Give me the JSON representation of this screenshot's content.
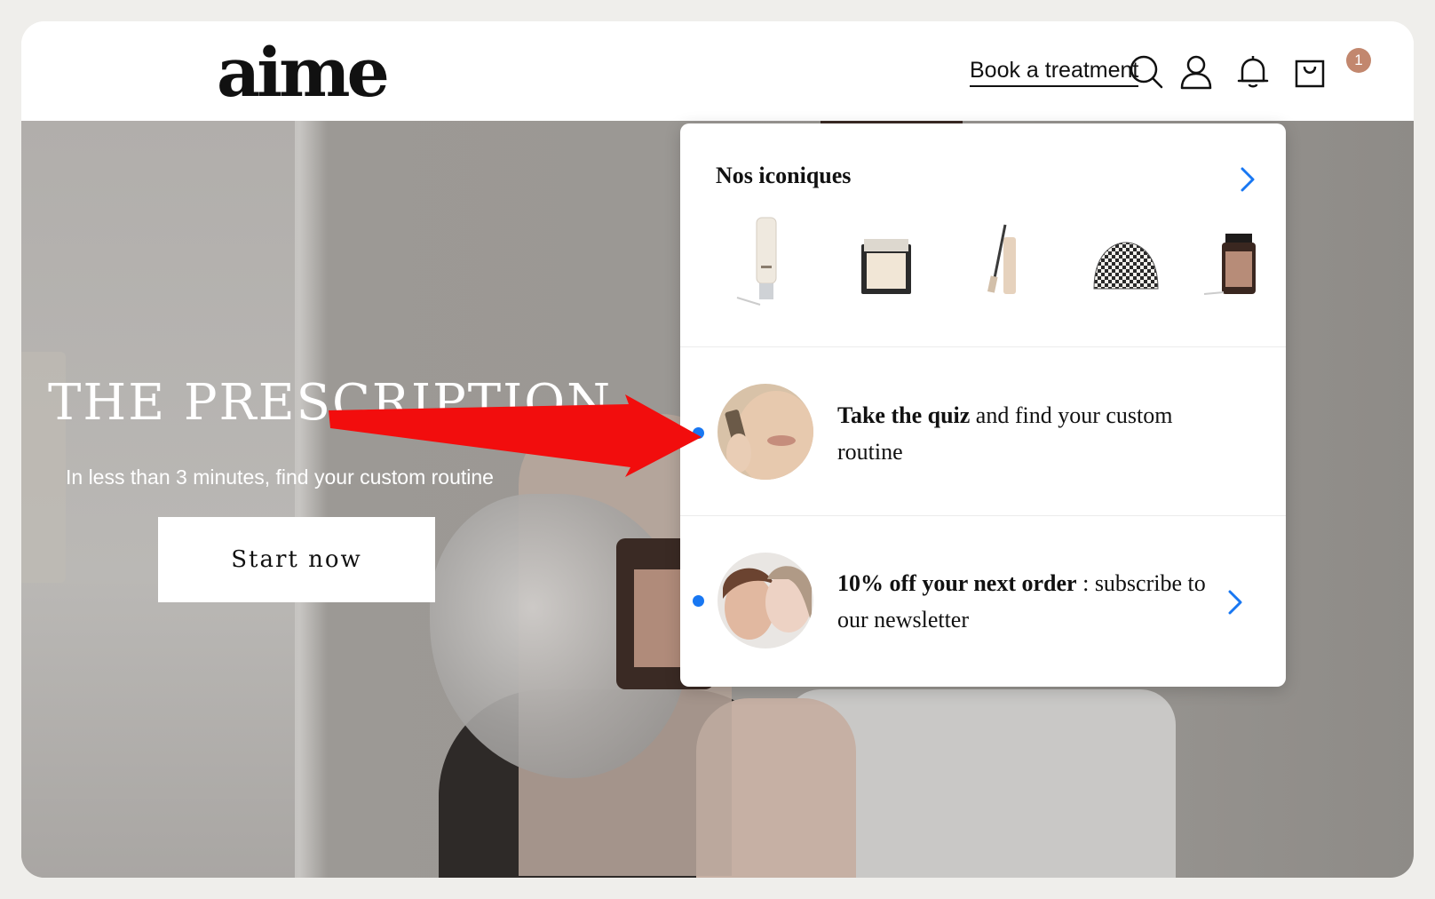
{
  "header": {
    "logo": "aime",
    "book_label": "Book a treatment",
    "cart_count": "1",
    "icons": [
      "search-icon",
      "user-icon",
      "bell-icon",
      "cart-icon"
    ]
  },
  "hero": {
    "title": "THE PRESCRIPTION",
    "subtitle": "In less than 3 minutes, find your custom routine",
    "cta": "Start now"
  },
  "popup": {
    "iconics": {
      "title": "Nos iconiques",
      "products": [
        "tube-product",
        "compact-product",
        "mascara-product",
        "pouch-product",
        "supplement-jar-product"
      ]
    },
    "quiz": {
      "bold": "Take the quiz",
      "text": " and find your custom routine"
    },
    "newsletter": {
      "bold": "10% off your next order",
      "text": " : subscribe to our newsletter"
    }
  },
  "colors": {
    "accent_blue": "#1877f2",
    "badge": "#c2876e",
    "annotation_red": "#f20d0d"
  }
}
